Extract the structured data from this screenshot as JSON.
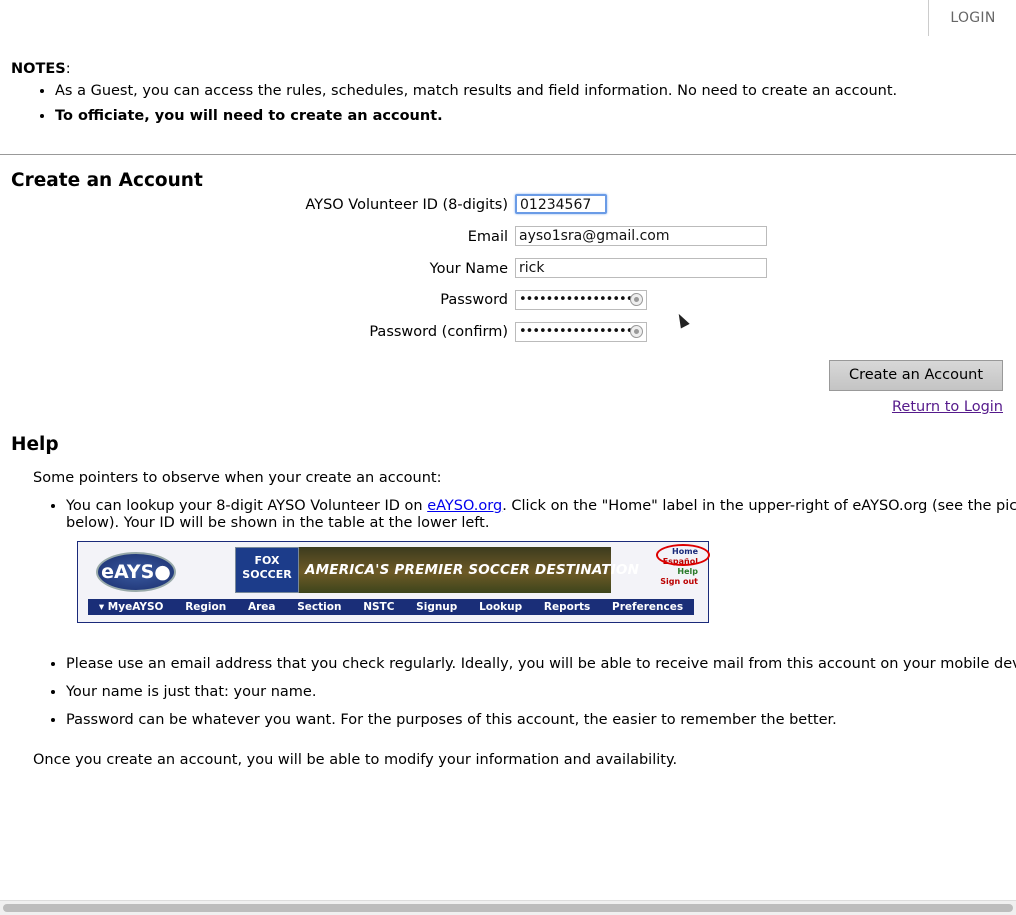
{
  "topbar": {
    "login_label": "LOGIN"
  },
  "notes": {
    "title": "NOTES",
    "colon": ":",
    "items": [
      "As a Guest, you can access the rules, schedules, match results and field information. No need to create an account.",
      "To officiate, you will need to create an account."
    ]
  },
  "create": {
    "heading": "Create an Account",
    "fields": {
      "volunteer_label": "AYSO Volunteer ID (8-digits)",
      "volunteer_value": "01234567",
      "email_label": "Email",
      "email_value": "ayso1sra@gmail.com",
      "name_label": "Your Name",
      "name_value": "rick",
      "password_label": "Password",
      "password_value": "••••••••••••••••••",
      "password_confirm_label": "Password (confirm)",
      "password_confirm_value": "••••••••••••••••••"
    },
    "submit_label": "Create an Account",
    "return_label": "Return to Login"
  },
  "help": {
    "heading": "Help",
    "intro": "Some pointers to observe when your create an account:",
    "item1_prefix": "You can lookup your 8-digit AYSO Volunteer ID on ",
    "item1_link": "eAYSO.org",
    "item1_suffix": ". Click on the \"Home\" label in the upper-right of eAYSO.org (see the picture below). Your ID will be shown in the table at the lower left.",
    "items": [
      "Please use an email address that you check regularly. Ideally, you will be able to receive mail from this account on your mobile device.",
      "Your name is just that: your name.",
      "Password can be whatever you want. For the purposes of this account, the easier to remember the better."
    ],
    "footer": "Once you create an account, you will be able to modify your information and availability."
  },
  "banner": {
    "logo": "eAYS●",
    "fox_line1": "FOX",
    "fox_line2": "SOCCER",
    "tagline": "AMERICA'S PREMIER SOCCER DESTINATION",
    "links": {
      "home": "Home",
      "espanol": "Español",
      "help": "Help",
      "signout": "Sign out"
    },
    "nav": [
      "▾ MyeAYSO",
      "Region",
      "Area",
      "Section",
      "NSTC",
      "Signup",
      "Lookup",
      "Reports",
      "Preferences"
    ]
  }
}
